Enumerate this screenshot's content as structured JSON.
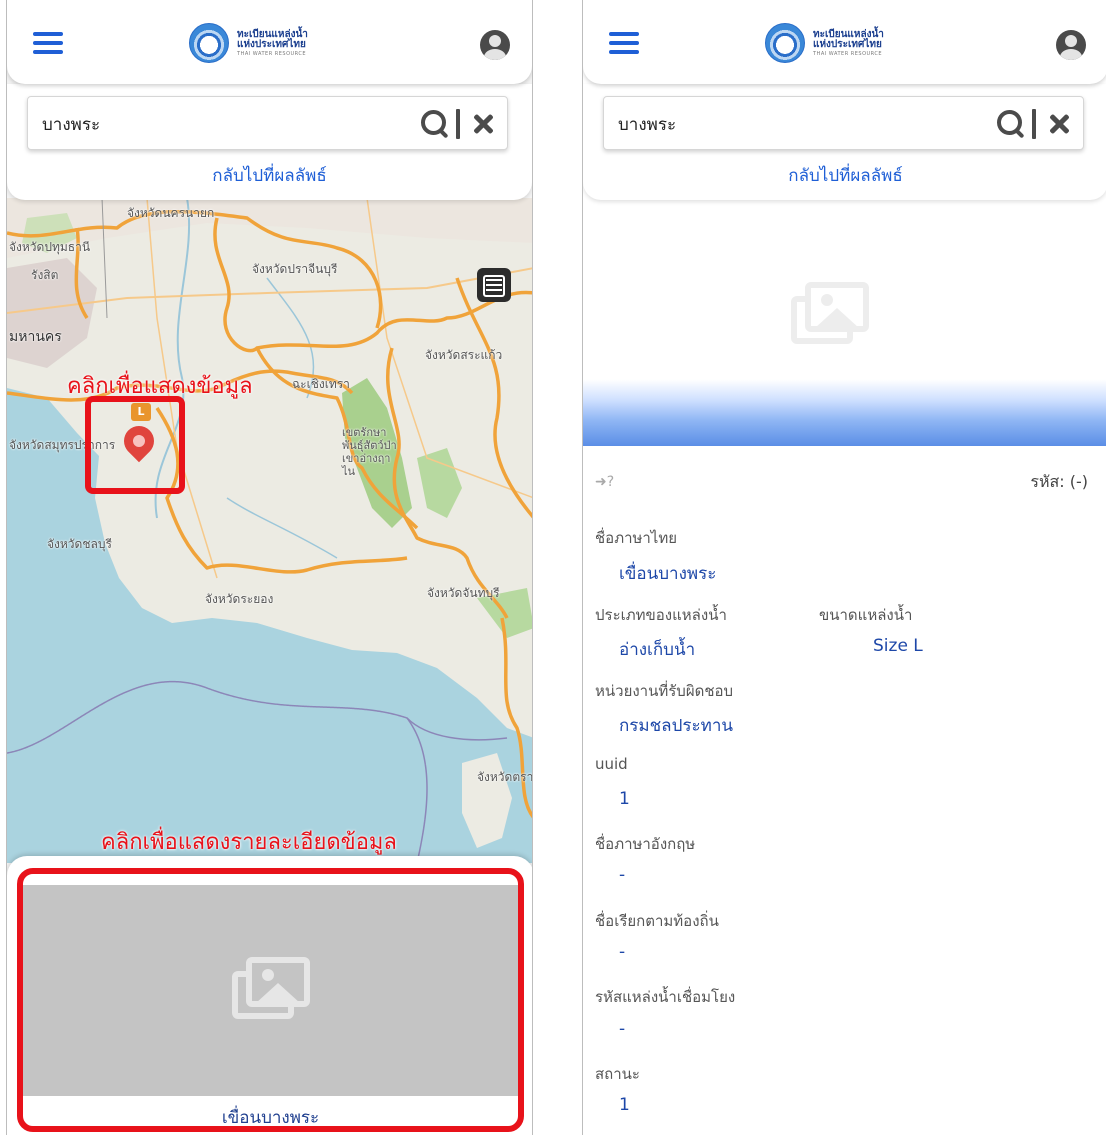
{
  "app": {
    "logo_th_line1": "ทะเบียนแหล่งน้ำ",
    "logo_th_line2": "แห่งประเทศไทย",
    "logo_en": "THAI WATER RESOURCE"
  },
  "search": {
    "value": "บางพระ",
    "back_label": "กลับไปที่ผลลัพธ์"
  },
  "map": {
    "labels": [
      "จังหวัดนครนายก",
      "จังหวัดปทุมธานี",
      "รังสิต",
      "จังหวัดปราจีนบุรี",
      "มหานคร",
      "จังหวัดสระแก้ว",
      "ฉะเชิงเทรา",
      "จังหวัดสมุทรปราการ",
      "เขตรักษาพันธุ์สัตว์ป่าเขาอ่างฤาไน",
      "จังหวัดชลบุรี",
      "จังหวัดระยอง",
      "จังหวัดจันทบุรี",
      "จังหวัดตราด"
    ],
    "marker_badge": "L",
    "annotation_top": "คลิกเพื่อแสดงข้อมูล",
    "annotation_bottom": "คลิกเพื่อแสดงรายละเอียดข้อมูล"
  },
  "sheet": {
    "title": "เขื่อนบางพระ"
  },
  "detail": {
    "code_text": "รหัส: (-)",
    "fields": [
      {
        "label": "ชื่อภาษาไทย",
        "value": "เขื่อนบางพระ"
      },
      {
        "label": "ประเภทของแหล่งน้ำ",
        "value": "อ่างเก็บน้ำ"
      },
      {
        "label": "ขนาดแหล่งน้ำ",
        "value": "Size L"
      },
      {
        "label": "หน่วยงานที่รับผิดชอบ",
        "value": "กรมชลประทาน"
      },
      {
        "label": "uuid",
        "value": "1"
      },
      {
        "label": "ชื่อภาษาอังกฤษ",
        "value": "-"
      },
      {
        "label": "ชื่อเรียกตามท้องถิ่น",
        "value": "-"
      },
      {
        "label": "รหัสแหล่งน้ำเชื่อมโยง",
        "value": "-"
      },
      {
        "label": "สถานะ",
        "value": "1"
      }
    ]
  },
  "colors": {
    "primary": "#1f5fd6",
    "annotation": "#e8121a",
    "marker": "#e0443d",
    "badge": "#e9952d",
    "water": "#aad3df",
    "province_border": "#f0a33a"
  }
}
